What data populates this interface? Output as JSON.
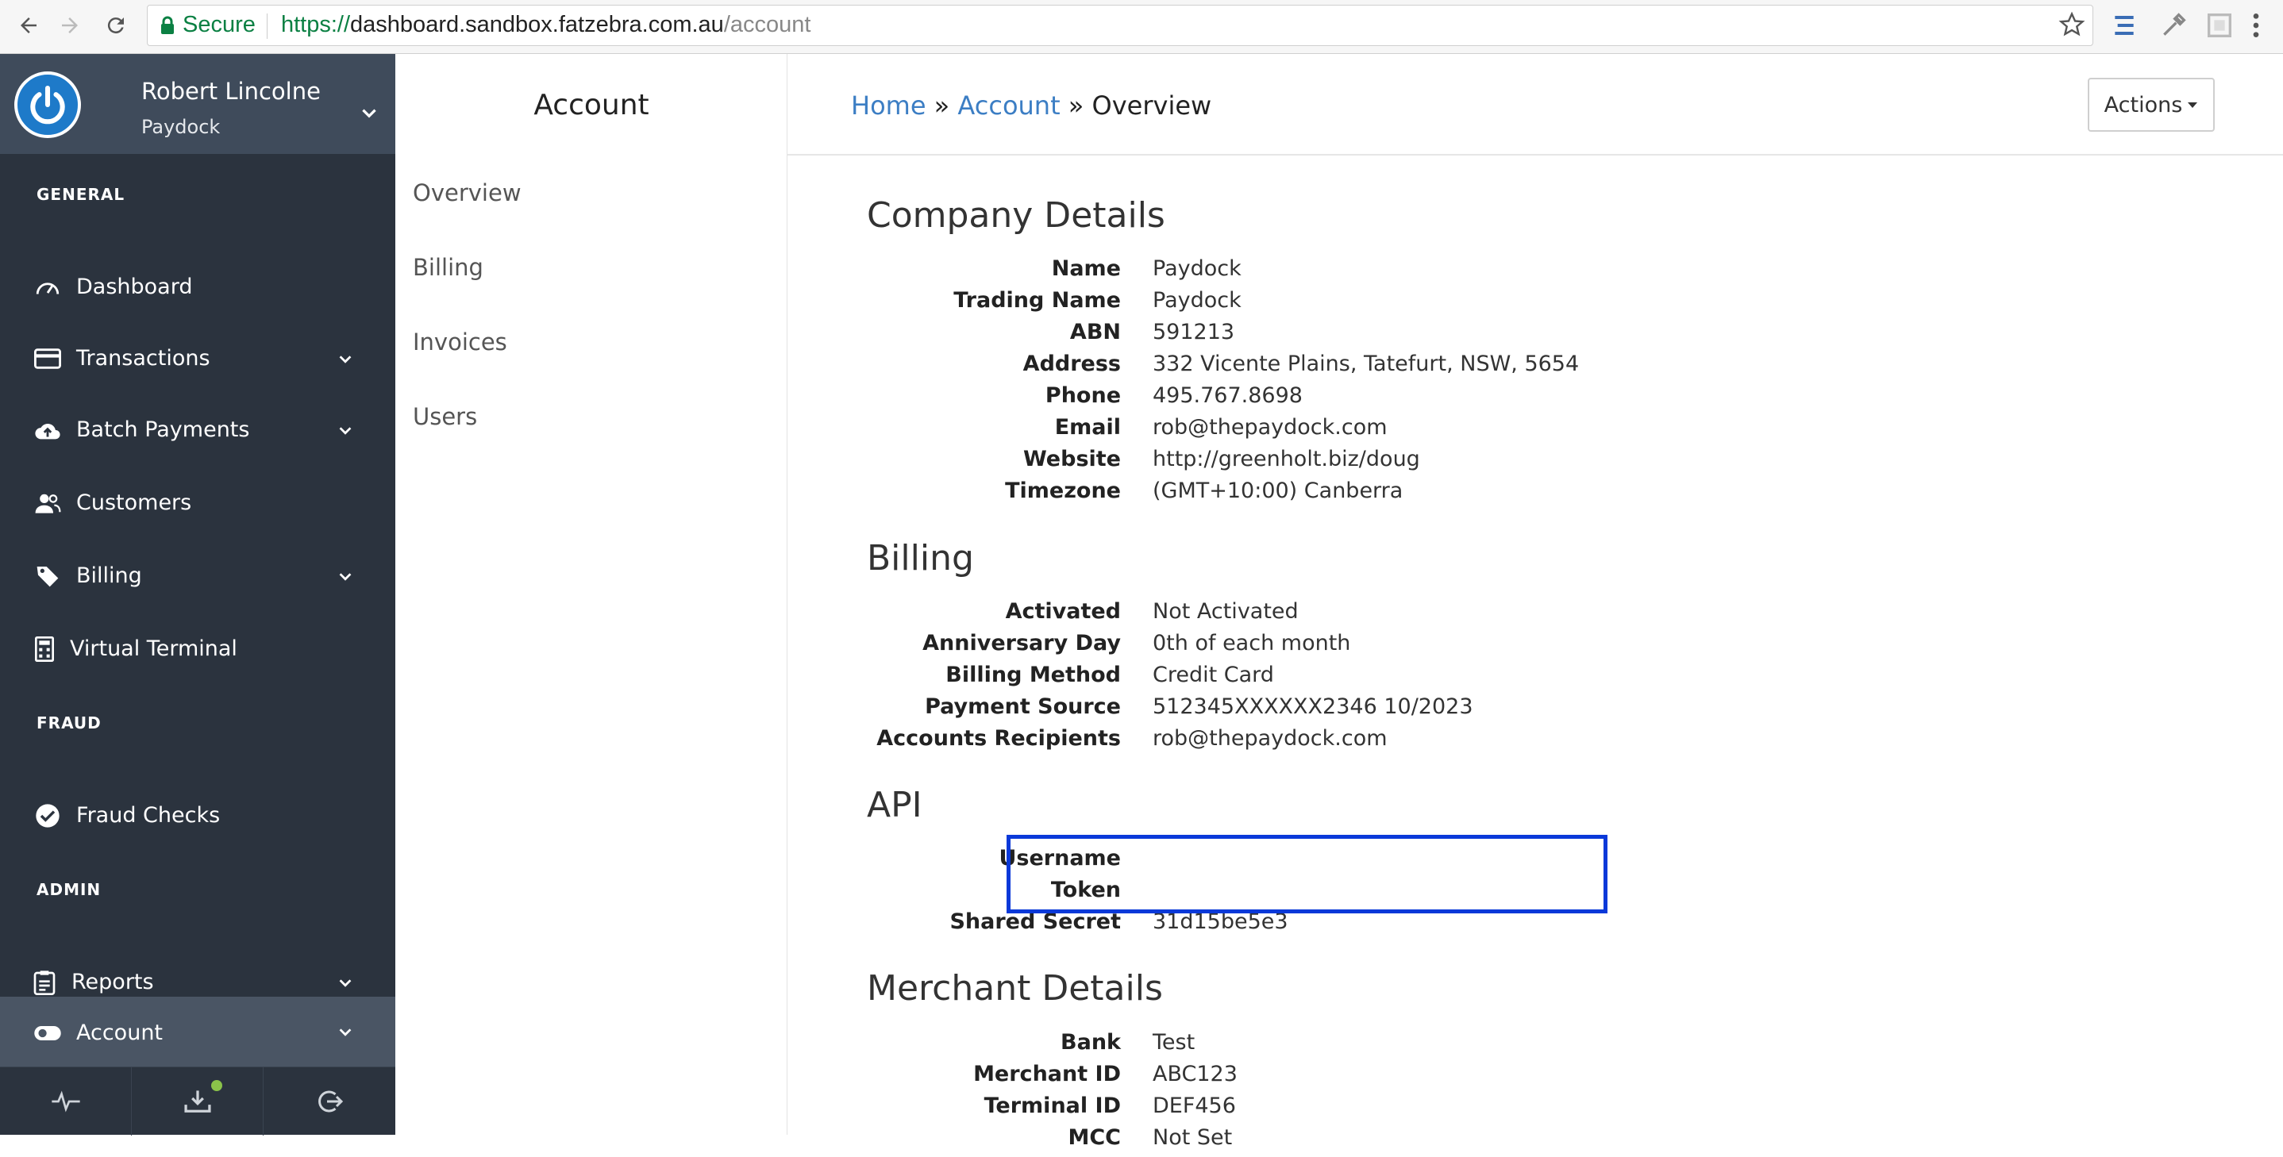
{
  "browser": {
    "secure_label": "Secure",
    "url_protocol": "https://",
    "url_host": "dashboard.sandbox.fatzebra.com.au",
    "url_path": "/account"
  },
  "sidebar": {
    "user_name": "Robert Lincolne",
    "company": "Paydock",
    "sections": {
      "general": "GENERAL",
      "fraud": "FRAUD",
      "admin": "ADMIN"
    },
    "items": [
      {
        "label": "Dashboard",
        "icon": "gauge-icon"
      },
      {
        "label": "Transactions",
        "icon": "credit-card-icon"
      },
      {
        "label": "Batch Payments",
        "icon": "cloud-upload-icon"
      },
      {
        "label": "Customers",
        "icon": "users-icon"
      },
      {
        "label": "Billing",
        "icon": "tag-icon"
      },
      {
        "label": "Virtual Terminal",
        "icon": "calculator-icon"
      },
      {
        "label": "Fraud Checks",
        "icon": "check-circle-icon"
      },
      {
        "label": "Reports",
        "icon": "clipboard-icon"
      },
      {
        "label": "Account",
        "icon": "toggle-icon"
      }
    ],
    "colors": {
      "bg": "#2b333e",
      "active": "#4a5564",
      "avatar": "#1e7ac9",
      "status_dot": "#8bc34a"
    }
  },
  "subnav": {
    "title": "Account",
    "links": [
      "Overview",
      "Billing",
      "Invoices",
      "Users"
    ]
  },
  "header": {
    "crumb_home": "Home",
    "crumb_account": "Account",
    "crumb_sep": "»",
    "crumb_current": "Overview",
    "actions_label": "Actions"
  },
  "company": {
    "heading": "Company Details",
    "fields": [
      {
        "k": "Name",
        "v": "Paydock"
      },
      {
        "k": "Trading Name",
        "v": "Paydock"
      },
      {
        "k": "ABN",
        "v": "591213"
      },
      {
        "k": "Address",
        "v": "332 Vicente Plains, Tatefurt, NSW, 5654"
      },
      {
        "k": "Phone",
        "v": "495.767.8698"
      },
      {
        "k": "Email",
        "v": "rob@thepaydock.com"
      },
      {
        "k": "Website",
        "v": "http://greenholt.biz/doug"
      },
      {
        "k": "Timezone",
        "v": "(GMT+10:00) Canberra"
      }
    ]
  },
  "billing": {
    "heading": "Billing",
    "fields": [
      {
        "k": "Activated",
        "v": "Not Activated"
      },
      {
        "k": "Anniversary Day",
        "v": "0th of each month"
      },
      {
        "k": "Billing Method",
        "v": "Credit Card"
      },
      {
        "k": "Payment Source",
        "v": "512345XXXXXX2346 10/2023"
      },
      {
        "k": "Accounts Recipients",
        "v": "rob@thepaydock.com"
      }
    ]
  },
  "api": {
    "heading": "API",
    "fields": [
      {
        "k": "Username",
        "v": ""
      },
      {
        "k": "Token",
        "v": ""
      },
      {
        "k": "Shared Secret",
        "v": "31d15be5e3"
      }
    ]
  },
  "merchant": {
    "heading": "Merchant Details",
    "fields": [
      {
        "k": "Bank",
        "v": "Test"
      },
      {
        "k": "Merchant ID",
        "v": "ABC123"
      },
      {
        "k": "Terminal ID",
        "v": "DEF456"
      },
      {
        "k": "MCC",
        "v": "Not Set"
      }
    ]
  },
  "colors": {
    "link": "#3c7ec4",
    "highlight_box": "#0a39d9",
    "secure_green": "#0b8043"
  }
}
